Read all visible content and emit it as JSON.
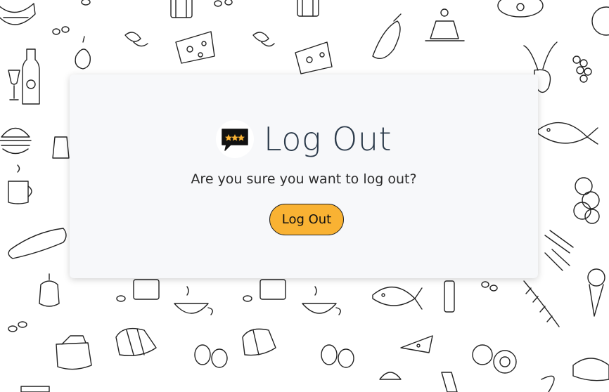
{
  "dialog": {
    "title": "Log Out",
    "message": "Are you sure you want to log out?",
    "button_label": "Log Out"
  },
  "colors": {
    "card_bg": "#f7f8fa",
    "title": "#2b3a4a",
    "button_bg": "#f9b233",
    "button_border": "#222222",
    "logo_accent": "#f9b233",
    "logo_dark": "#111111"
  },
  "icons": {
    "logo": "rating-chat-bubble-icon",
    "background": "food-doodle-pattern"
  }
}
